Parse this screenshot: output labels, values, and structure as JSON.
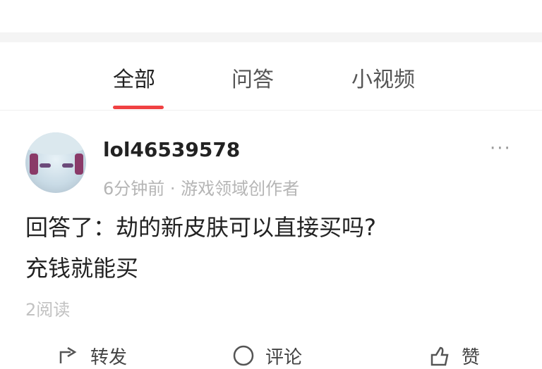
{
  "top": {
    "faded_text": ""
  },
  "tabs": [
    {
      "label": "全部",
      "active": true
    },
    {
      "label": "问答",
      "active": false
    },
    {
      "label": "小视频",
      "active": false
    }
  ],
  "post": {
    "username": "lol46539578",
    "meta": "6分钟前 · 游戏领域创作者",
    "more_label": "···",
    "question": "回答了：劫的新皮肤可以直接买吗?",
    "answer": "充钱就能买",
    "reads": "2阅读"
  },
  "actions": [
    {
      "icon": "share-icon",
      "label": "转发"
    },
    {
      "icon": "comment-icon",
      "label": "评论"
    },
    {
      "icon": "like-icon",
      "label": "赞"
    }
  ],
  "colors": {
    "accent": "#f04142",
    "muted": "#b5b5b5",
    "divider": "#f4f4f4"
  }
}
